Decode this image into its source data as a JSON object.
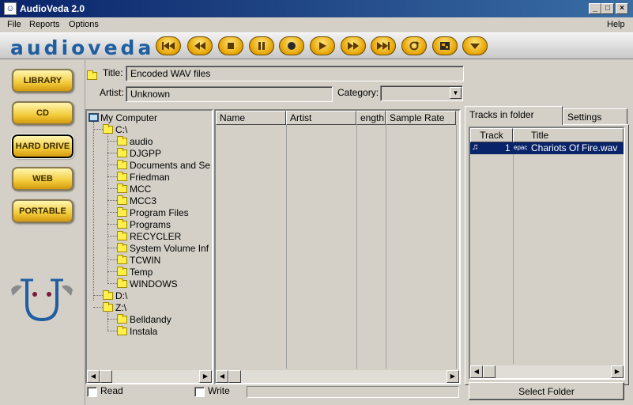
{
  "window": {
    "title": "AudioVeda 2.0",
    "controls": {
      "minimize": "_",
      "maximize": "□",
      "close": "×"
    }
  },
  "menu": {
    "file": "File",
    "reports": "Reports",
    "options": "Options",
    "help": "Help"
  },
  "toolbar": {
    "logo": "audioveda",
    "buttons": [
      "prev-track-icon",
      "rewind-icon",
      "stop-icon",
      "pause-icon",
      "record-icon",
      "play-icon",
      "fast-forward-icon",
      "next-track-icon",
      "repeat-icon",
      "shuffle-icon",
      "eject-icon"
    ]
  },
  "nav": {
    "library": "LIBRARY",
    "cd": "CD",
    "hard_drive": "HARD DRIVE",
    "web": "WEB",
    "portable": "PORTABLE",
    "active": "HARD DRIVE"
  },
  "info": {
    "title_label": "Title:",
    "title_value": "Encoded WAV files",
    "artist_label": "Artist:",
    "artist_value": "Unknown",
    "category_label": "Category:",
    "category_value": ""
  },
  "tree": {
    "root": "My Computer",
    "c_drive": "C:\\",
    "c_folders": [
      "audio",
      "DJGPP",
      "Documents and Se",
      "Friedman",
      "MCC",
      "MCC3",
      "Program Files",
      "Programs",
      "RECYCLER",
      "System Volume Inf",
      "TCWIN",
      "Temp",
      "WINDOWS"
    ],
    "d_drive": "D:\\",
    "z_drive": "Z:\\",
    "z_folders": [
      "Belldandy",
      "Instala"
    ]
  },
  "filelist": {
    "columns": [
      "Name",
      "Artist",
      "ength",
      "Sample Rate"
    ]
  },
  "right_panel": {
    "tab_tracks": "Tracks in folder",
    "tab_settings": "Settings",
    "col_track": "Track",
    "col_title": "Title",
    "rows": [
      {
        "track": "1",
        "tag": "epac",
        "title": "Chariots Of Fire.wav"
      }
    ],
    "select_folder": "Select Folder"
  },
  "bottom": {
    "read_label": "Read",
    "write_label": "Write"
  },
  "colors": {
    "titlebar": "#0a246a",
    "selection": "#0a246a",
    "nav_button": "#f2cb3a",
    "toolbar_button": "#e6a300"
  }
}
